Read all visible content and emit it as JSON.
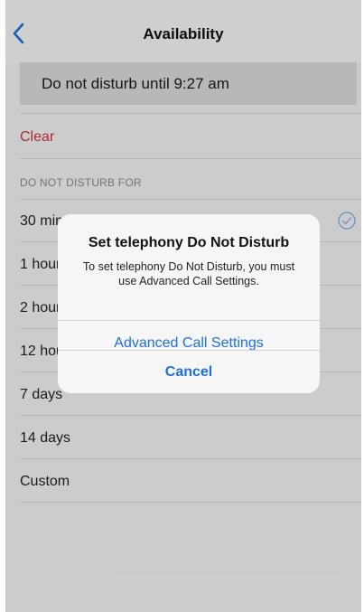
{
  "navbar": {
    "title": "Availability",
    "back_icon": "chevron-left-icon"
  },
  "status": {
    "text": "Do not disturb until 9:27 am"
  },
  "clear_label": "Clear",
  "section_header": "DO NOT DISTURB FOR",
  "options": [
    {
      "label": "30 minutes",
      "selected": true
    },
    {
      "label": "1 hour"
    },
    {
      "label": "2 hours"
    },
    {
      "label": "12 hours"
    },
    {
      "label": "7 days"
    },
    {
      "label": "14 days"
    },
    {
      "label": "Custom"
    }
  ],
  "dialog": {
    "title": "Set telephony Do Not Disturb",
    "message": "To set telephony Do Not Disturb, you must use Advanced Call Settings.",
    "primary_action": "Advanced Call Settings",
    "cancel_action": "Cancel"
  },
  "colors": {
    "accent": "#1f6fdc",
    "destructive": "#d2323a"
  }
}
